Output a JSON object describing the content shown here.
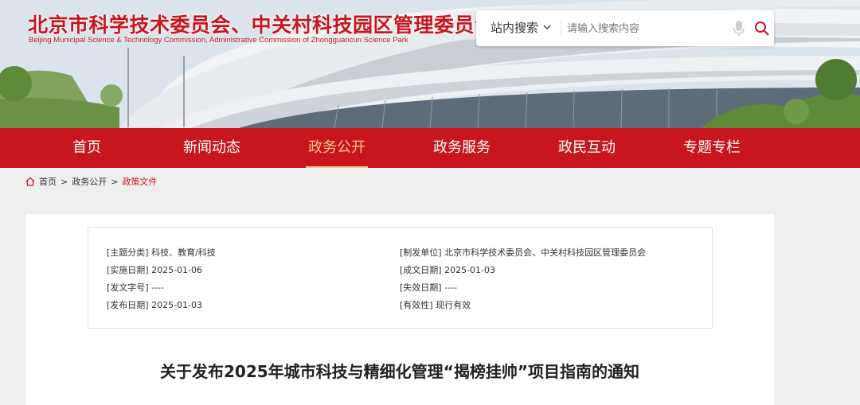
{
  "header": {
    "title": "北京市科学技术委员会、中关村科技园区管理委员会",
    "subtitle": "Beijing Municipal Science & Technology Commission, Administrative Commission of Zhongguancun Science Park"
  },
  "search": {
    "scope_label": "站内搜索",
    "placeholder": "请输入搜索内容"
  },
  "nav": {
    "items": [
      {
        "label": "首页"
      },
      {
        "label": "新闻动态"
      },
      {
        "label": "政务公开",
        "active": true
      },
      {
        "label": "政务服务"
      },
      {
        "label": "政民互动"
      },
      {
        "label": "专题专栏"
      }
    ]
  },
  "breadcrumb": {
    "items": [
      "首页",
      "政务公开",
      "政策文件"
    ]
  },
  "meta": {
    "left": [
      {
        "label": "[主题分类]",
        "value": "科技、教育/科技"
      },
      {
        "label": "[实施日期]",
        "value": "2025-01-06"
      },
      {
        "label": "[发文字号]",
        "value": "----"
      },
      {
        "label": "[发布日期]",
        "value": "2025-01-03"
      }
    ],
    "right": [
      {
        "label": "[制发单位]",
        "value": "北京市科学技术委员会、中关村科技园区管理委员会"
      },
      {
        "label": "[成文日期]",
        "value": "2025-01-03"
      },
      {
        "label": "[失效日期]",
        "value": "----"
      },
      {
        "label": "[有效性]",
        "value": "现行有效"
      }
    ]
  },
  "document": {
    "title": "关于发布2025年城市科技与精细化管理“揭榜挂帅”项目指南的通知"
  },
  "colors": {
    "brand_red": "#c8161e",
    "nav_active": "#f6c78d",
    "page_bg": "#efefef"
  },
  "icons": {
    "home": "home-icon",
    "mic": "microphone-icon",
    "search": "search-icon",
    "chevron": "chevron-down-icon"
  }
}
